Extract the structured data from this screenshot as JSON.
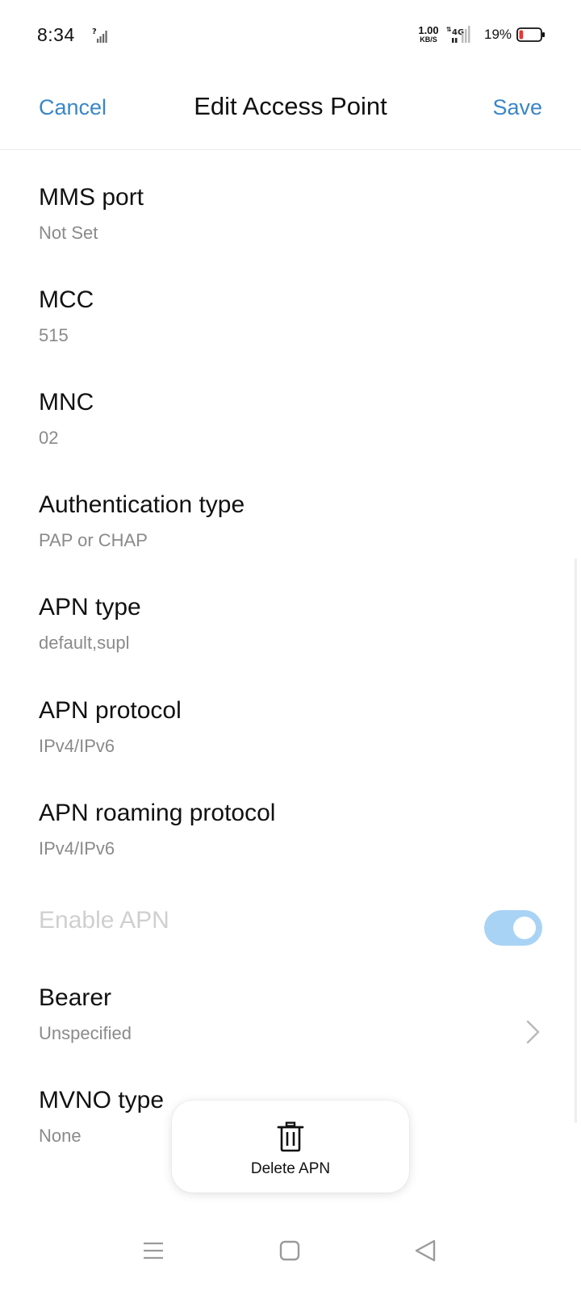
{
  "status_bar": {
    "time": "8:34",
    "sim_icon": "no-sim-signal-icon",
    "net_speed_value": "1.00",
    "net_speed_unit": "KB/S",
    "network_type": "4G",
    "battery_percent": "19%",
    "battery_level": 0.19
  },
  "toolbar": {
    "cancel_label": "Cancel",
    "title": "Edit Access Point",
    "save_label": "Save"
  },
  "settings": [
    {
      "title": "MMS port",
      "value": "Not Set"
    },
    {
      "title": "MCC",
      "value": "515"
    },
    {
      "title": "MNC",
      "value": "02"
    },
    {
      "title": "Authentication type",
      "value": "PAP or CHAP"
    },
    {
      "title": "APN type",
      "value": "default,supl"
    },
    {
      "title": "APN protocol",
      "value": "IPv4/IPv6"
    },
    {
      "title": "APN roaming protocol",
      "value": "IPv4/IPv6"
    }
  ],
  "enable_apn": {
    "title": "Enable APN",
    "enabled": true,
    "disabled_row": true
  },
  "bearer": {
    "title": "Bearer",
    "value": "Unspecified"
  },
  "mvno": {
    "title": "MVNO type",
    "value": "None"
  },
  "delete_action": {
    "label": "Delete APN",
    "icon": "trash-icon"
  },
  "colors": {
    "accent": "#3a86c8",
    "toggle_track": "#a9d3f5",
    "battery_low": "#e53935"
  },
  "nav": {
    "menu_icon": "menu-icon",
    "home_icon": "home-square-icon",
    "back_icon": "back-triangle-icon"
  }
}
